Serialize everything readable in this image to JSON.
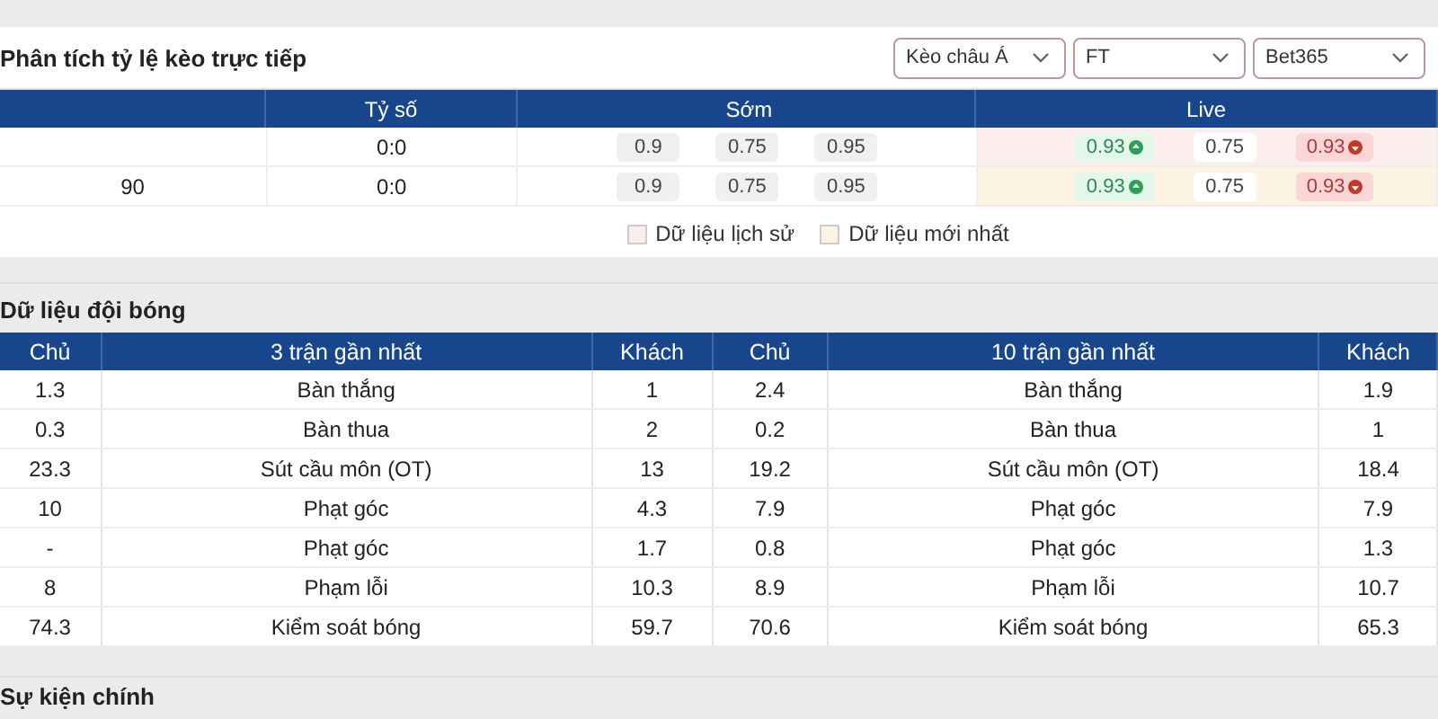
{
  "odds_panel": {
    "title": "Phân tích tỷ lệ kèo trực tiếp",
    "selects": [
      {
        "value": "Kèo châu Á"
      },
      {
        "value": "FT"
      },
      {
        "value": "Bet365"
      }
    ],
    "columns": [
      "Tỷ số",
      "Sớm",
      "Live"
    ],
    "rows": [
      {
        "minute": "",
        "score": "0:0",
        "early": [
          "0.9",
          "0.75",
          "0.95"
        ],
        "color": "#fdeeee",
        "live": [
          {
            "value": "0.93",
            "kind": "up"
          },
          {
            "value": "0.75",
            "kind": "plain"
          },
          {
            "value": "0.93",
            "kind": "down"
          }
        ]
      },
      {
        "minute": "90",
        "score": "0:0",
        "early": [
          "0.9",
          "0.75",
          "0.95"
        ],
        "color": "#fdf3e3",
        "live": [
          {
            "value": "0.93",
            "kind": "up"
          },
          {
            "value": "0.75",
            "kind": "plain"
          },
          {
            "value": "0.93",
            "kind": "down"
          }
        ]
      }
    ],
    "legend": [
      {
        "label": "Dữ liệu lịch sử",
        "color": "#fdeeee"
      },
      {
        "label": "Dữ liệu mới nhất",
        "color": "#fdf3e3"
      }
    ]
  },
  "team_data": {
    "title": "Dữ liệu đội bóng",
    "columns": [
      "Chủ",
      "3 trận gần nhất",
      "Khách",
      "Chủ",
      "10 trận gần nhất",
      "Khách"
    ],
    "rows": [
      [
        "1.3",
        "Bàn thắng",
        "1",
        "2.4",
        "Bàn thắng",
        "1.9"
      ],
      [
        "0.3",
        "Bàn thua",
        "2",
        "0.2",
        "Bàn thua",
        "1"
      ],
      [
        "23.3",
        "Sút cầu môn (OT)",
        "13",
        "19.2",
        "Sút cầu môn (OT)",
        "18.4"
      ],
      [
        "10",
        "Phạt góc",
        "4.3",
        "7.9",
        "Phạt góc",
        "7.9"
      ],
      [
        "-",
        "Phạt góc",
        "1.7",
        "0.8",
        "Phạt góc",
        "1.3"
      ],
      [
        "8",
        "Phạm lỗi",
        "10.3",
        "8.9",
        "Phạm lỗi",
        "10.7"
      ],
      [
        "74.3",
        "Kiểm soát bóng",
        "59.7",
        "70.6",
        "Kiểm soát bóng",
        "65.3"
      ]
    ]
  },
  "events": {
    "title": "Sự kiện chính"
  }
}
